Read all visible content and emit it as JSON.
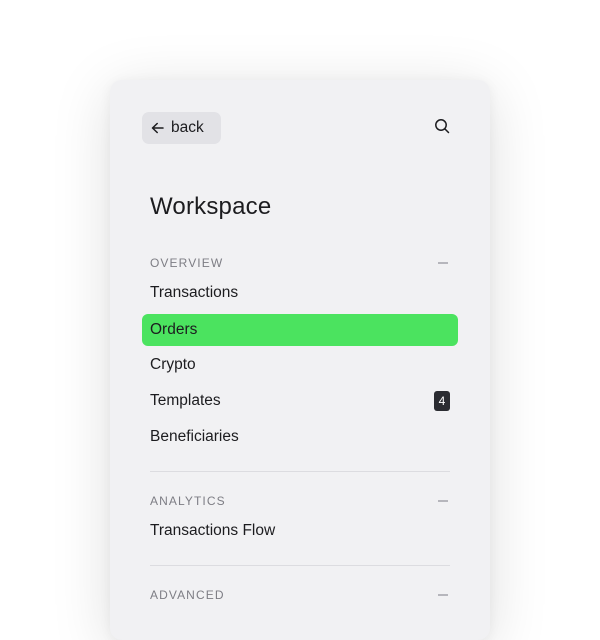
{
  "header": {
    "back_label": "back",
    "back_icon": "arrow-left-icon",
    "search_icon": "search-icon"
  },
  "title": "Workspace",
  "sections": [
    {
      "label": "OVERVIEW",
      "items": [
        {
          "label": "Transactions",
          "active": false
        },
        {
          "label": "Orders",
          "active": true
        },
        {
          "label": "Crypto",
          "active": false
        },
        {
          "label": "Templates",
          "active": false,
          "badge": "4"
        },
        {
          "label": "Beneficiaries",
          "active": false
        }
      ]
    },
    {
      "label": "ANALYTICS",
      "items": [
        {
          "label": "Transactions Flow",
          "active": false
        }
      ]
    },
    {
      "label": "ADVANCED",
      "items": []
    }
  ],
  "colors": {
    "panel_bg": "#f1f1f3",
    "active_item_bg": "#4be35f",
    "badge_bg": "#2b2c31",
    "section_label": "#7d7d84"
  }
}
